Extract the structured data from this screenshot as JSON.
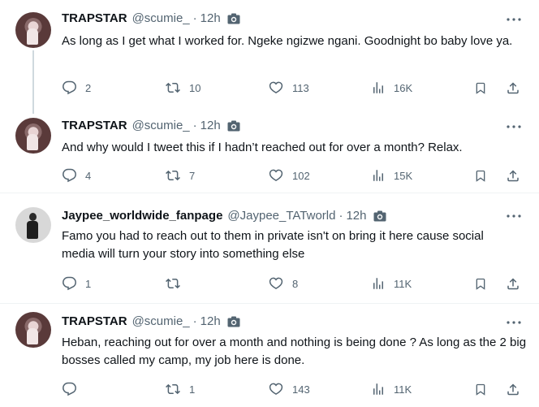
{
  "tweets": [
    {
      "name": "TRAPSTAR",
      "handle": "@scumie_",
      "time": "12h",
      "text": "As long as I get what I worked for. Ngeke ngizwe ngani. Goodnight bo baby love ya.",
      "replies": "2",
      "retweets": "10",
      "likes": "113",
      "views": "16K"
    },
    {
      "name": "TRAPSTAR",
      "handle": "@scumie_",
      "time": "12h",
      "text": "And why would I tweet this if I hadn’t reached out for over a month? Relax.",
      "replies": "4",
      "retweets": "7",
      "likes": "102",
      "views": "15K"
    },
    {
      "name": "Jaypee_worldwide_fanpage",
      "handle": "@Jaypee_TATworld",
      "time": "12h",
      "text": "Famo you had to reach out to them in private isn't on bring it here cause social media will turn your story into something else",
      "replies": "1",
      "retweets": "",
      "likes": "8",
      "views": "11K"
    },
    {
      "name": "TRAPSTAR",
      "handle": "@scumie_",
      "time": "12h",
      "text": "Heban, reaching out for over a month and nothing is being done ? As long as the 2 big bosses called my camp, my job here is done.",
      "replies": "",
      "retweets": "1",
      "likes": "143",
      "views": "11K"
    }
  ],
  "separator": "·",
  "icons": {
    "reply": "reply-icon",
    "retweet": "retweet-icon",
    "like": "heart-icon",
    "views": "views-icon",
    "bookmark": "bookmark-icon",
    "share": "share-icon",
    "more": "more-icon",
    "media": "camera-icon"
  },
  "colors": {
    "text": "#0f1419",
    "muted": "#536471",
    "line": "#cfd9de"
  }
}
